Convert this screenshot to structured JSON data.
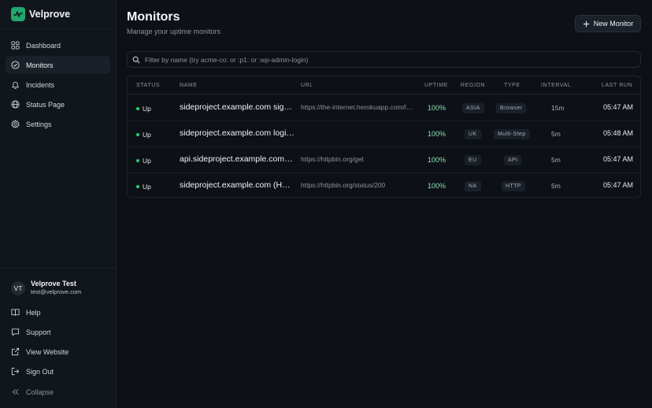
{
  "brand": {
    "name": "Velprove"
  },
  "nav": [
    {
      "label": "Dashboard",
      "icon": "grid-icon"
    },
    {
      "label": "Monitors",
      "icon": "check-circle-icon",
      "active": true
    },
    {
      "label": "Incidents",
      "icon": "bell-icon"
    },
    {
      "label": "Status Page",
      "icon": "globe-icon"
    },
    {
      "label": "Settings",
      "icon": "gear-icon"
    }
  ],
  "user": {
    "initials": "VT",
    "name": "Velprove Test",
    "email": "test@velprove.com"
  },
  "footer_nav": [
    {
      "label": "Help",
      "icon": "book-icon"
    },
    {
      "label": "Support",
      "icon": "message-icon"
    },
    {
      "label": "View Website",
      "icon": "external-link-icon"
    },
    {
      "label": "Sign Out",
      "icon": "sign-out-icon"
    },
    {
      "label": "Collapse",
      "icon": "chevrons-left-icon"
    }
  ],
  "page": {
    "title": "Monitors",
    "subtitle": "Manage your uptime monitors",
    "new_button": "New Monitor",
    "filter_placeholder": "Filter by name (try acme-co: or :p1: or :wp-admin-login)"
  },
  "table": {
    "headers": [
      "STATUS",
      "NAME",
      "URL",
      "UPTIME",
      "REGION",
      "TYPE",
      "INTERVAL",
      "LAST RUN"
    ],
    "rows": [
      {
        "status": "Up",
        "name": "sideproject.example.com sign-up",
        "url": "https://the-internet.herokuapp.com/login",
        "uptime": "100%",
        "region": "ASIA",
        "type": "Browser",
        "interval": "15m",
        "last_run": "05:47 AM"
      },
      {
        "status": "Up",
        "name": "sideproject.example.com login flow",
        "url": "",
        "uptime": "100%",
        "region": "UK",
        "type": "Multi-Step",
        "interval": "5m",
        "last_run": "05:48 AM"
      },
      {
        "status": "Up",
        "name": "api.sideproject.example.com (API)",
        "url": "https://httpbin.org/get",
        "uptime": "100%",
        "region": "EU",
        "type": "API",
        "interval": "5m",
        "last_run": "05:47 AM"
      },
      {
        "status": "Up",
        "name": "sideproject.example.com (HTTP)",
        "url": "https://httpbin.org/status/200",
        "uptime": "100%",
        "region": "NA",
        "type": "HTTP",
        "interval": "5m",
        "last_run": "05:47 AM"
      }
    ]
  },
  "colors": {
    "accent": "#22a66d",
    "status_up": "#2ecc71",
    "uptime_text": "#86e0b0",
    "background": "#0d1117"
  }
}
